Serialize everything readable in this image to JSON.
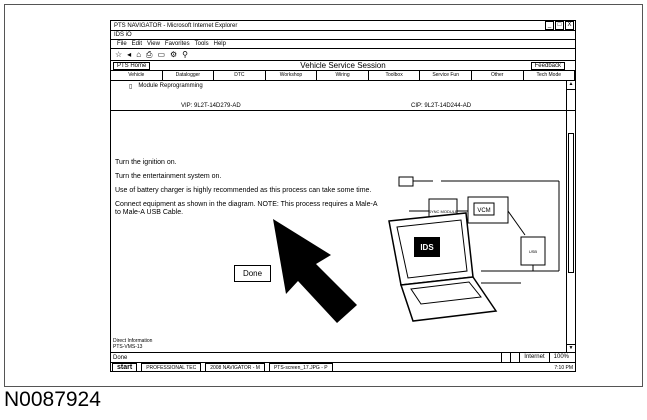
{
  "caption": "N0087924",
  "browser": {
    "title": "PTS NAVIGATOR - Microsoft Internet Explorer",
    "address": "IDS iO",
    "menu": [
      "File",
      "Edit",
      "View",
      "Favorites",
      "Tools",
      "Help"
    ],
    "toolbar_icons": [
      "star-icon",
      "back-icon",
      "home-icon",
      "print-icon",
      "page-icon",
      "safety-icon",
      "tools-icon"
    ],
    "window_buttons": [
      "_",
      "□",
      "X"
    ]
  },
  "session": {
    "home_tab": "PTS Home",
    "title": "Vehicle Service Session",
    "feedback": "Feedback",
    "tabs": [
      "Vehicle",
      "Datalogger",
      "DTC",
      "Workshop",
      "Wiring",
      "Toolbox",
      "Service Fun",
      "Other",
      "Tech Mode"
    ],
    "crumb_icon": "folder-icon",
    "crumb": "Module Reprogramming",
    "vin_left": "VIP: 9L2T-14D279-AD",
    "vin_right": "CIP: 9L2T-14D244-AD"
  },
  "instructions": [
    "Turn the ignition on.",
    "Turn the entertainment system on.",
    "Use of battery charger is highly recommended as this process can take some time.",
    "Connect equipment as shown in the diagram. NOTE: This process requires a Male-A to Male-A USB Cable."
  ],
  "done_label": "Done",
  "footer_note": [
    "Direct Information",
    "PTS-VMS-13"
  ],
  "diagram": {
    "laptop_label": "IDS",
    "vcm_label": "VCM",
    "box_labels": [
      "SYNC MODULE",
      "USB"
    ]
  },
  "statusbar": {
    "text": "Done",
    "zone": "Internet",
    "zoom": "100%"
  },
  "taskbar": {
    "start": "start",
    "tasks": [
      "PROFESSIONAL TEC",
      "2008 NAVIGATOR - M",
      "PTS-screen_17.JPG - P"
    ],
    "time": "7:10 PM"
  }
}
